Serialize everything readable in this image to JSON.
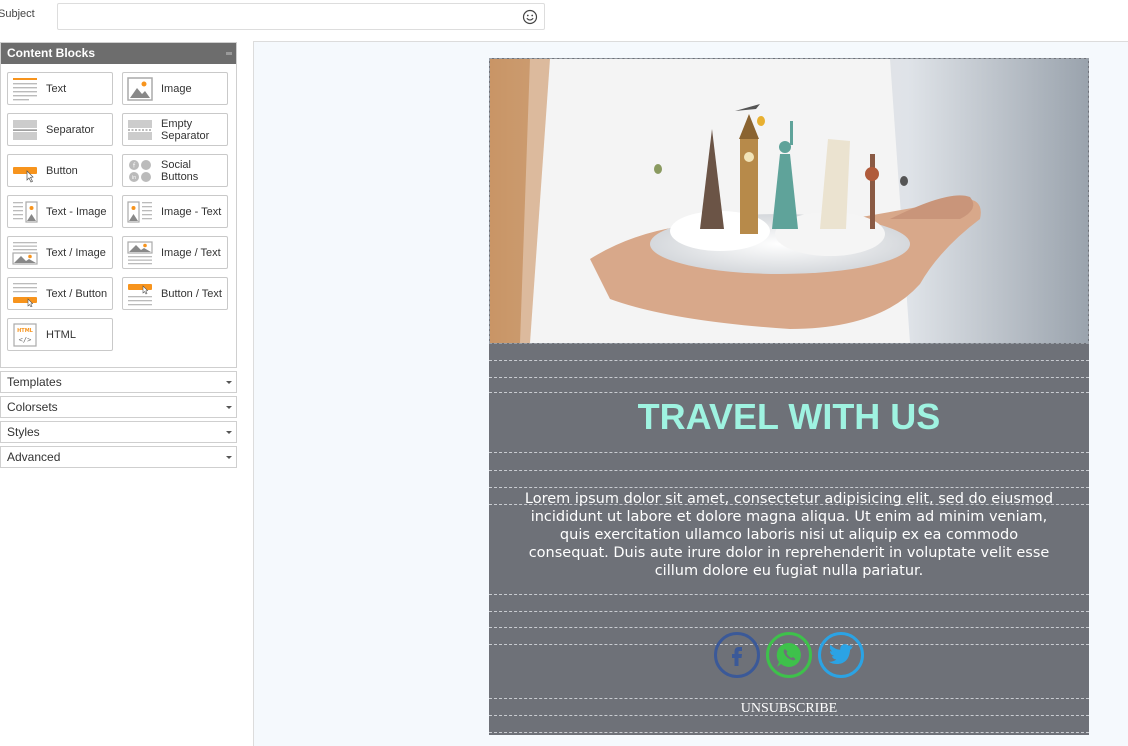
{
  "subject": {
    "label": "Subject",
    "value": "",
    "placeholder": ""
  },
  "sidebar": {
    "content_blocks_title": "Content Blocks",
    "blocks": [
      {
        "label": "Text",
        "icon": "text-block-icon"
      },
      {
        "label": "Image",
        "icon": "image-block-icon"
      },
      {
        "label": "Separator",
        "icon": "separator-block-icon"
      },
      {
        "label": "Empty Separator",
        "icon": "empty-separator-block-icon"
      },
      {
        "label": "Button",
        "icon": "button-block-icon"
      },
      {
        "label": "Social Buttons",
        "icon": "social-buttons-block-icon"
      },
      {
        "label": "Text - Image",
        "icon": "text-image-block-icon"
      },
      {
        "label": "Image - Text",
        "icon": "image-text-block-icon"
      },
      {
        "label": "Text / Image",
        "icon": "text-over-image-block-icon"
      },
      {
        "label": "Image / Text",
        "icon": "image-over-text-block-icon"
      },
      {
        "label": "Text / Button",
        "icon": "text-over-button-block-icon"
      },
      {
        "label": "Button / Text",
        "icon": "button-over-text-block-icon"
      },
      {
        "label": "HTML",
        "icon": "html-block-icon"
      }
    ],
    "sections": [
      "Templates",
      "Colorsets",
      "Styles",
      "Advanced"
    ]
  },
  "email": {
    "headline": "TRAVEL WITH US",
    "body": "Lorem ipsum dolor sit amet, consectetur adipisicing elit, sed do eiusmod incididunt ut labore et dolore magna aliqua. Ut enim ad minim veniam, quis exercitation ullamco laboris nisi ut aliquip ex ea commodo consequat. Duis aute irure dolor in reprehenderit in voluptate velit esse cillum dolore eu fugiat nulla pariatur.",
    "unsubscribe": "UNSUBSCRIBE",
    "socials": [
      {
        "icon": "facebook-icon",
        "color": "#3b5998"
      },
      {
        "icon": "whatsapp-icon",
        "color": "#3ec14b"
      },
      {
        "icon": "twitter-icon",
        "color": "#2ba3e4"
      }
    ]
  },
  "colors": {
    "accent": "#f7941d",
    "panel_header": "#6d6d6d",
    "email_bg": "#6e7178",
    "headline": "#9ff3e1"
  }
}
